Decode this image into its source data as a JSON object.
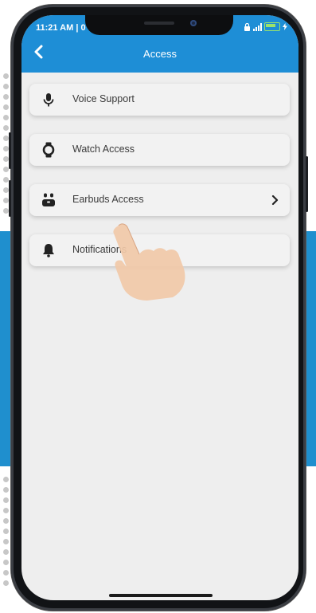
{
  "status_bar": {
    "time": "11:21 AM | 0"
  },
  "header": {
    "title": "Access",
    "back_icon": "chevron-left-icon"
  },
  "menu": {
    "items": [
      {
        "label": "Voice Support",
        "icon": "microphone-icon",
        "has_chevron": false
      },
      {
        "label": "Watch Access",
        "icon": "watch-icon",
        "has_chevron": false
      },
      {
        "label": "Earbuds Access",
        "icon": "earbuds-icon",
        "has_chevron": true
      },
      {
        "label": "Notifications",
        "icon": "bell-icon",
        "has_chevron": false
      }
    ]
  },
  "colors": {
    "header_bg": "#1e8ed6",
    "screen_bg": "#eeeeee",
    "card_bg": "#f2f2f2",
    "accent_band": "#1f8fce"
  }
}
